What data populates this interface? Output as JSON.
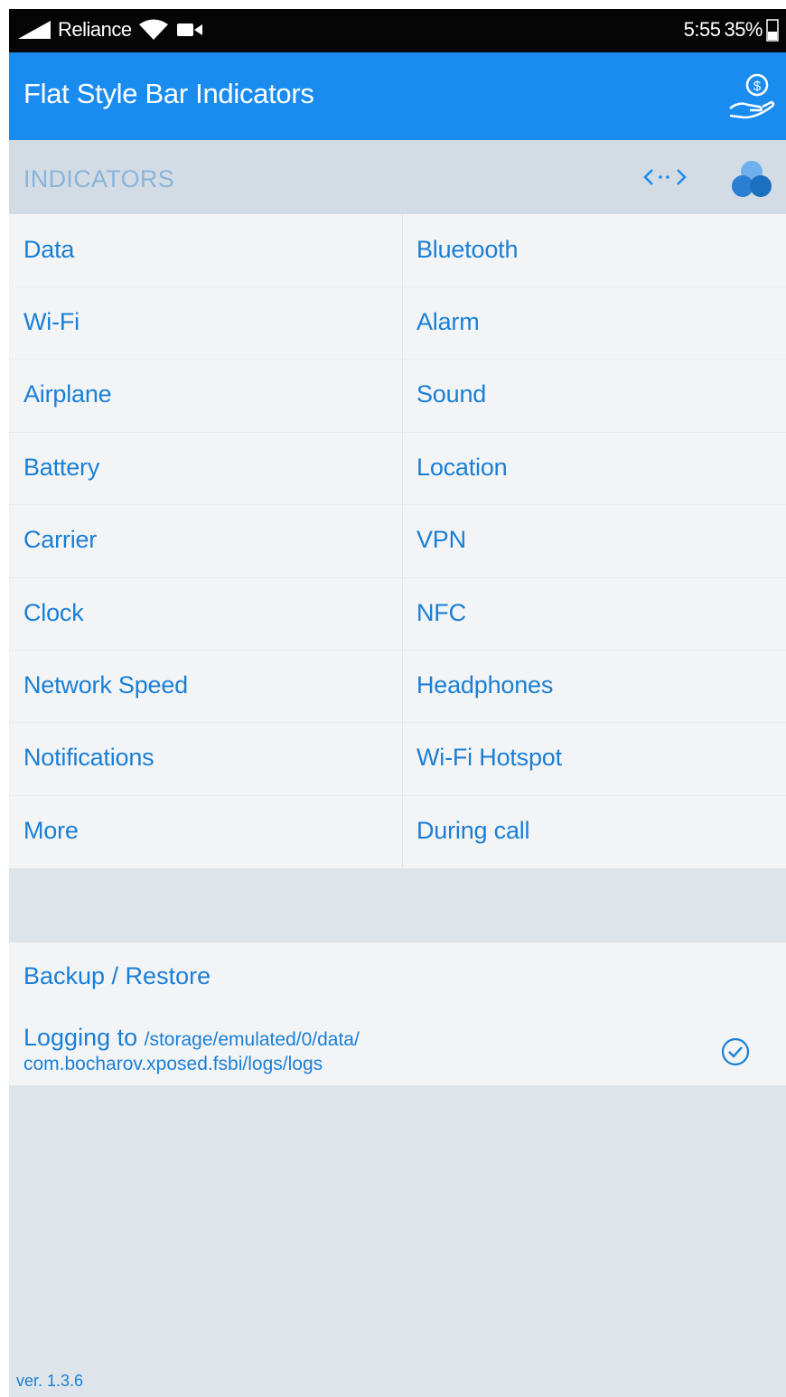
{
  "status_bar": {
    "carrier": "Reliance",
    "time": "5:55",
    "battery_percent": "35%"
  },
  "app_bar": {
    "title": "Flat Style Bar Indicators",
    "action_icon": "donate-hand-coin-icon"
  },
  "section": {
    "title": "INDICATORS",
    "icons": [
      "code-brackets-icon",
      "overlapping-circles-icon"
    ]
  },
  "indicators": {
    "left": [
      "Data",
      "Wi-Fi",
      "Airplane",
      "Battery",
      "Carrier",
      "Clock",
      "Network Speed",
      "Notifications",
      "More"
    ],
    "right": [
      "Bluetooth",
      "Alarm",
      "Sound",
      "Location",
      "VPN",
      "NFC",
      "Headphones",
      "Wi-Fi Hotspot",
      "During call"
    ]
  },
  "settings": {
    "backup_label": "Backup / Restore",
    "logging_label": "Logging to",
    "logging_path_1": "/storage/emulated/0/data/",
    "logging_path_2": "com.bocharov.xposed.fsbi/logs/logs",
    "logging_enabled": true
  },
  "footer": {
    "version": "ver. 1.3.6"
  },
  "colors": {
    "accent": "#1a8cf0",
    "link_text": "#1a7fd6",
    "section_title": "#8ab4dc",
    "background": "#dde4ea"
  }
}
